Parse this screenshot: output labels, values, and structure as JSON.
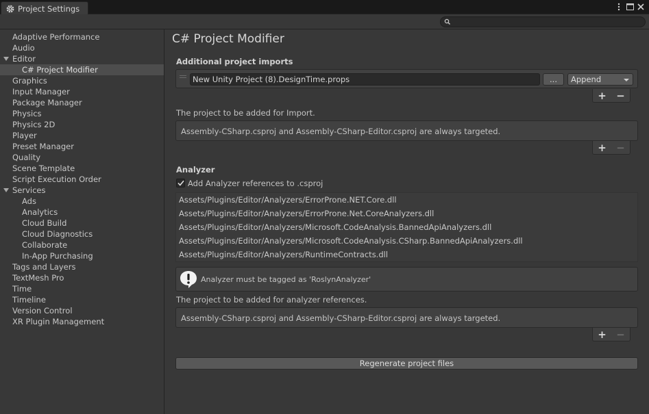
{
  "window": {
    "tab_title": "Project Settings"
  },
  "search": {
    "placeholder": ""
  },
  "sidebar": {
    "items": [
      {
        "label": "Adaptive Performance",
        "level": 0
      },
      {
        "label": "Audio",
        "level": 0
      },
      {
        "label": "Editor",
        "level": 0,
        "expanded": true
      },
      {
        "label": "C# Project Modifier",
        "level": 1,
        "selected": true
      },
      {
        "label": "Graphics",
        "level": 0
      },
      {
        "label": "Input Manager",
        "level": 0
      },
      {
        "label": "Package Manager",
        "level": 0
      },
      {
        "label": "Physics",
        "level": 0
      },
      {
        "label": "Physics 2D",
        "level": 0
      },
      {
        "label": "Player",
        "level": 0
      },
      {
        "label": "Preset Manager",
        "level": 0
      },
      {
        "label": "Quality",
        "level": 0
      },
      {
        "label": "Scene Template",
        "level": 0
      },
      {
        "label": "Script Execution Order",
        "level": 0
      },
      {
        "label": "Services",
        "level": 0,
        "expanded": true
      },
      {
        "label": "Ads",
        "level": 1
      },
      {
        "label": "Analytics",
        "level": 1
      },
      {
        "label": "Cloud Build",
        "level": 1
      },
      {
        "label": "Cloud Diagnostics",
        "level": 1
      },
      {
        "label": "Collaborate",
        "level": 1
      },
      {
        "label": "In-App Purchasing",
        "level": 1
      },
      {
        "label": "Tags and Layers",
        "level": 0
      },
      {
        "label": "TextMesh Pro",
        "level": 0
      },
      {
        "label": "Time",
        "level": 0
      },
      {
        "label": "Timeline",
        "level": 0
      },
      {
        "label": "Version Control",
        "level": 0
      },
      {
        "label": "XR Plugin Management",
        "level": 0
      }
    ]
  },
  "main": {
    "title": "C# Project Modifier",
    "imports": {
      "header": "Additional project imports",
      "entry_path": "New Unity Project (8).DesignTime.props",
      "browse_label": "...",
      "mode": "Append",
      "add_label": "+",
      "remove_label": "−",
      "target_label": "The project to be added for Import.",
      "target_info": "Assembly-CSharp.csproj and Assembly-CSharp-Editor.csproj are always targeted."
    },
    "analyzer": {
      "header": "Analyzer",
      "checkbox_label": "Add Analyzer references to .csproj",
      "checked": true,
      "dlls": [
        "Assets/Plugins/Editor/Analyzers/ErrorProne.NET.Core.dll",
        "Assets/Plugins/Editor/Analyzers/ErrorProne.Net.CoreAnalyzers.dll",
        "Assets/Plugins/Editor/Analyzers/Microsoft.CodeAnalysis.BannedApiAnalyzers.dll",
        "Assets/Plugins/Editor/Analyzers/Microsoft.CodeAnalysis.CSharp.BannedApiAnalyzers.dll",
        "Assets/Plugins/Editor/Analyzers/RuntimeContracts.dll"
      ],
      "help_text": "Analyzer must be tagged as 'RoslynAnalyzer'",
      "target_label": "The project to be added for analyzer references.",
      "target_info": "Assembly-CSharp.csproj and Assembly-CSharp-Editor.csproj are always targeted."
    },
    "regenerate_label": "Regenerate project files"
  },
  "colors": {
    "background": "#383838",
    "tab_bar": "#191919",
    "selected_row": "#4d4d4d",
    "field": "#2a2a2a",
    "button": "#585858"
  }
}
